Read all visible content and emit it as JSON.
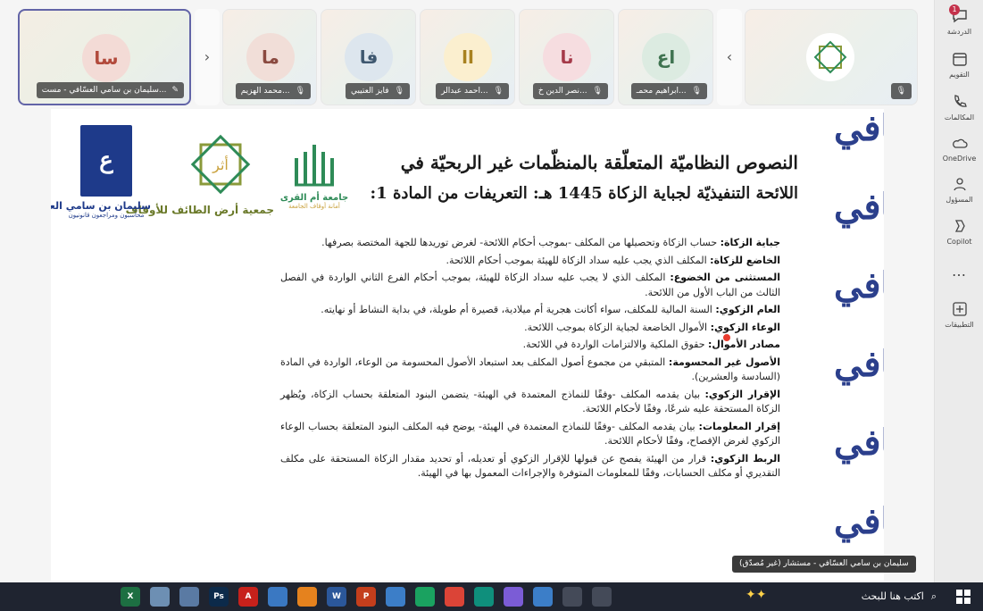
{
  "rail": {
    "items": [
      {
        "label": "الدردشة",
        "icon": "chat-icon",
        "badge": "1"
      },
      {
        "label": "التقويم",
        "icon": "calendar-icon"
      },
      {
        "label": "المكالمات",
        "icon": "phone-icon"
      },
      {
        "label": "OneDrive",
        "icon": "cloud-icon"
      },
      {
        "label": "المسؤول",
        "icon": "admin-icon"
      },
      {
        "label": "Copilot",
        "icon": "copilot-icon"
      },
      {
        "label": "…",
        "icon": "more-icon"
      },
      {
        "label": "التطبيقات",
        "icon": "apps-plus-icon"
      }
    ]
  },
  "participants": [
    {
      "initials": "سا",
      "name": "سليمان بن سامي العسّافي - مست...",
      "avatar_bg": "#f3dbd6",
      "avatar_fg": "#b24a3c",
      "pinned": true
    },
    {
      "initials": "ما",
      "name": "محمد الهزيم...",
      "avatar_bg": "#f1ded8",
      "avatar_fg": "#8a4a40"
    },
    {
      "initials": "فا",
      "name": "فايز العتيبي",
      "avatar_bg": "#dde6ee",
      "avatar_fg": "#3f5870"
    },
    {
      "initials": "اا",
      "name": "احمد عبدالر...",
      "avatar_bg": "#fbefcf",
      "avatar_fg": "#a88220"
    },
    {
      "initials": "نا",
      "name": "نصر الدين خ...",
      "avatar_bg": "#f6dde0",
      "avatar_fg": "#a53a49"
    },
    {
      "initials": "اع",
      "name": "ابراهيم محمـ...",
      "avatar_bg": "#dcebe1",
      "avatar_fg": "#3f7350"
    }
  ],
  "slide": {
    "title_line1": "النصوص النظاميّة المتعلّقة بالمنظّمات غير الربحيّة في",
    "title_line2": "اللائحة التنفيذيّة لجباية الزكاة 1445 هـ: التعريفات من المادة 1:",
    "logos": {
      "umm_alqura_name": "جامعة أم القرى",
      "umm_alqura_sub": "أمانة أوقاف الجامعة",
      "awqaf_name": "جمعية أرض الطائف للأوقاف",
      "awqaf_mark": "أثر",
      "assafi_name": "سليمان بن سامي العسّافي",
      "assafi_sub": "محاسبون ومراجعون قانونيون"
    },
    "pattern_text": "عسافي",
    "definitions": [
      {
        "term": "جباية الزكاة:",
        "text": " حساب الزكاة وتحصيلها من المكلف -بموجب أحكام اللائحة- لغرض توريدها للجهة المختصة بصرفها."
      },
      {
        "term": "الخاضع للزكاة:",
        "text": " المكلف الذي يجب عليه سداد الزكاة للهيئة بموجب أحكام اللائحة."
      },
      {
        "term": "المستثنى من الخضوع:",
        "text": " المكلف الذي لا يجب عليه سداد الزكاة للهيئة، بموجب أحكام الفرع الثاني الواردة في الفصل الثالث من الباب الأول من اللائحة."
      },
      {
        "term": "العام الزكوي:",
        "text": " السنة المالية للمكلف، سواء أكانت هجرية أم ميلادية، قصيرة أم طويلة، في بداية النشاط أو نهايته."
      },
      {
        "term": "الوعاء الزكوي:",
        "text": " الأموال الخاضعة لجباية الزكاة بموجب اللائحة."
      },
      {
        "term": "مصادر الأموال:",
        "text": " حقوق الملكية والالتزامات الواردة في اللائحة."
      },
      {
        "term": "الأصول غير المحسومة:",
        "text": " المتبقي من مجموع أصول المكلف بعد استبعاد الأصول المحسومة من الوعاء، الواردة في المادة (السادسة والعشرين)."
      },
      {
        "term": "الإقرار الزكوي:",
        "text": " بيان يقدمه المكلف -وفقًا للنماذج المعتمدة في الهيئة- يتضمن البنود المتعلقة بحساب الزكاة، ويُظهر الزكاة المستحقة عليه شرعًا، وفقًا لأحكام اللائحة."
      },
      {
        "term": "إقرار المعلومات:",
        "text": " بيان يقدمه المكلف -وفقًا للنماذج المعتمدة في الهيئة- يوضح فيه المكلف البنود المتعلقة بحساب الوعاء الزكوي لغرض الإفصاح، وفقًا لأحكام اللائحة."
      },
      {
        "term": "الربط الزكوي:",
        "text": " قرار من الهيئة يفصح عن قبولها للإقرار الزكوي أو تعديله، أو تحديد مقدار الزكاة المستحقة على مكلف التقديري أو مكلف الحسابات، وفقًا للمعلومات المتوفرة والإجراءات المعمول بها في الهيئة."
      }
    ]
  },
  "presenter_tooltip": "سليمان بن سامي العسّافي - مستشار (غير مُصدّق)",
  "taskbar": {
    "search_placeholder": "اكتب هنا للبحث",
    "apps": [
      {
        "label": "X",
        "color": "#1d6f42"
      },
      {
        "label": "",
        "color": "#6d8fb3"
      },
      {
        "label": "",
        "color": "#5a7aa3"
      },
      {
        "label": "Ps",
        "color": "#0c2a4a"
      },
      {
        "label": "A",
        "color": "#c7211b"
      },
      {
        "label": "",
        "color": "#3a78c2"
      },
      {
        "label": "",
        "color": "#e5821e"
      },
      {
        "label": "W",
        "color": "#2b579a"
      },
      {
        "label": "P",
        "color": "#c43e1c"
      },
      {
        "label": "",
        "color": "#3c7ec8"
      },
      {
        "label": "",
        "color": "#1aa260"
      },
      {
        "label": "",
        "color": "#db4437"
      },
      {
        "label": "",
        "color": "#0f8f7c"
      },
      {
        "label": "",
        "color": "#7b5cd6"
      },
      {
        "label": "",
        "color": "#3c7ec8"
      },
      {
        "label": "",
        "color": "#444a58"
      },
      {
        "label": "",
        "color": "#444a58"
      }
    ]
  }
}
